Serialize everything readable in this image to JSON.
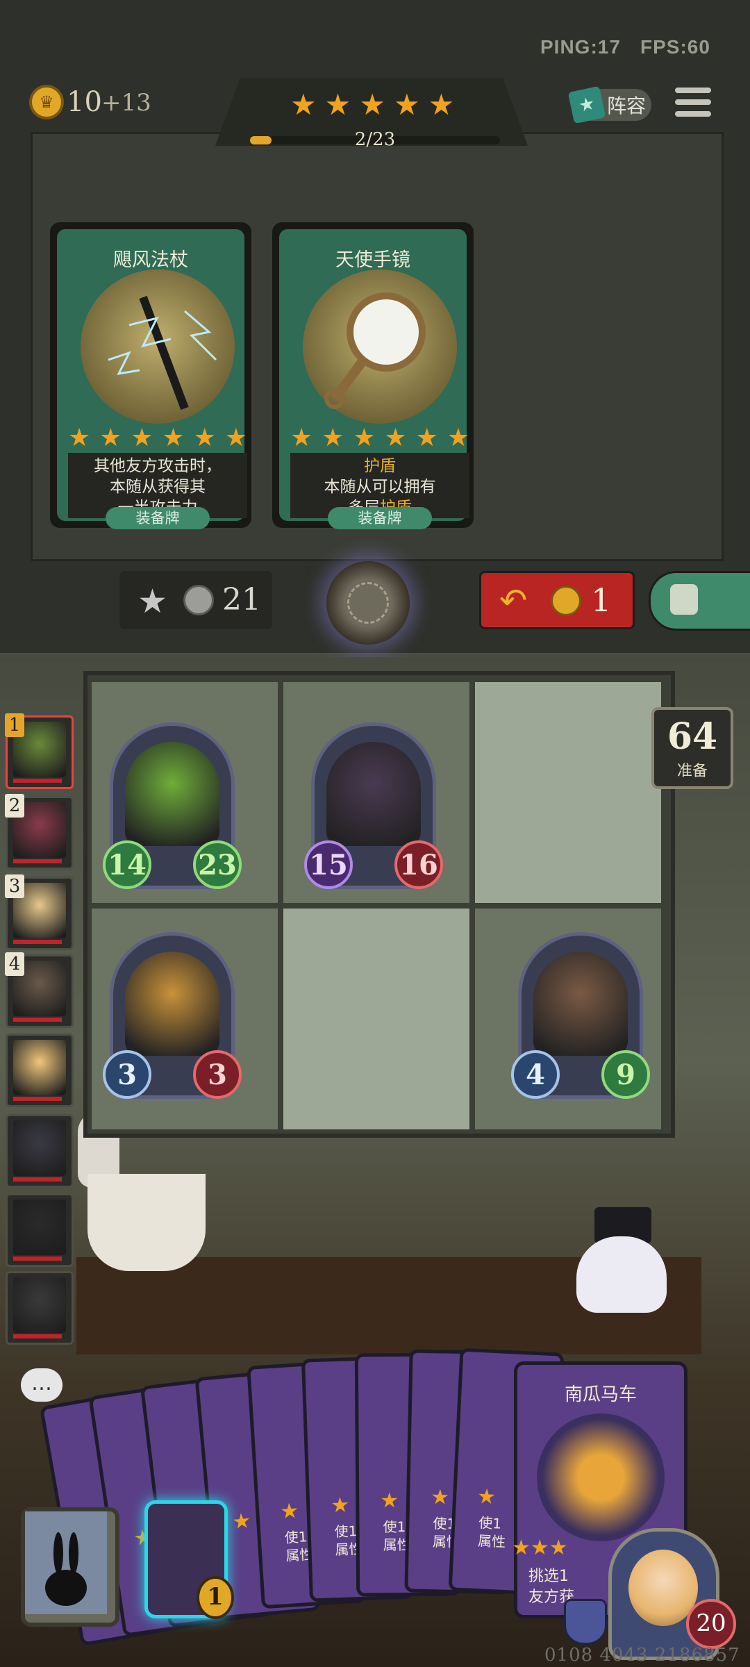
{
  "hud": {
    "ping_label": "PING:17",
    "fps_label": "FPS:60",
    "gold": "10",
    "gold_income": "+13",
    "tier_stars": [
      "★",
      "★",
      "★",
      "★",
      "★"
    ],
    "tier_progress_text": "2/23",
    "tier_progress_fraction": 0.087,
    "lineup_label": "阵容",
    "lineup_icon": "lineup-card-icon",
    "menu_icon": "hamburger-icon"
  },
  "shop": {
    "cards": [
      {
        "title": "飓风法杖",
        "stars": [
          "★",
          "★",
          "★",
          "★",
          "★",
          "★"
        ],
        "desc_lines": [
          "其他友方攻击时，",
          "本随从获得其",
          "一半攻击力"
        ],
        "tag": "装备牌",
        "art_icon": "lightning-staff-icon"
      },
      {
        "title": "天使手镜",
        "stars": [
          "★",
          "★",
          "★",
          "★",
          "★",
          "★"
        ],
        "keyword": "护盾",
        "desc_lines": [
          "本随从可以拥有",
          "多层"
        ],
        "desc_keyword_inline": "护盾",
        "tag": "装备牌",
        "art_icon": "hand-mirror-icon"
      }
    ],
    "upgrade_cost": "21",
    "upgrade_icon": "star-up-icon",
    "refresh_cost": "1",
    "refresh_icon": "refresh-arrow-icon",
    "lock_icon": "unlock-icon",
    "watch_icon": "pocket-watch-icon",
    "colors": {
      "refresh_bg": "#b82523",
      "lock_bg": "#3f8a6a",
      "gold": "#e0a826"
    }
  },
  "board": {
    "minions": [
      {
        "name": "leaf-girl",
        "attack": "14",
        "health": "23",
        "atk_style": "g",
        "hp_style": "g",
        "face": "#6fae3a"
      },
      {
        "name": "demon-skull",
        "attack": "15",
        "health": "16",
        "atk_style": "p",
        "hp_style": "r",
        "face": "#4a3a52"
      },
      {
        "name": "golden-paladin",
        "attack": "3",
        "health": "3",
        "atk_style": "b",
        "hp_style": "r",
        "face": "#c9923a"
      },
      {
        "name": "mohawk-warrior",
        "attack": "4",
        "health": "9",
        "atk_style": "b",
        "hp_style": "g",
        "face": "#7a5a44"
      }
    ],
    "ready_count": "64",
    "ready_label": "准备"
  },
  "lineup": {
    "slots": [
      {
        "num": "1",
        "face": "#6a8a3a"
      },
      {
        "num": "2",
        "face": "#8a3a4a"
      },
      {
        "num": "3",
        "face": "#e6c88a"
      },
      {
        "num": "4",
        "face": "#6a5a4a"
      },
      {
        "num": "",
        "face": "#f0c67a"
      },
      {
        "num": "",
        "face": "#3a3a44"
      },
      {
        "num": "",
        "face": "#2a2a2a"
      },
      {
        "num": "",
        "face": "#3a3a3a"
      }
    ]
  },
  "hand": {
    "cards": [
      {
        "text": ""
      },
      {
        "text": ""
      },
      {
        "text": ""
      },
      {
        "text": ""
      },
      {
        "text": "使1\n属性"
      },
      {
        "text": "使1\n属性"
      },
      {
        "text": "使1\n属性"
      },
      {
        "text": "使1\n属性"
      },
      {
        "text": "使1\n属性"
      }
    ],
    "featured_title": "南瓜马车",
    "featured_stars": "★★★",
    "featured_desc": "挑选1\n友方获",
    "selected_cost": "1",
    "emote_icon": "chat-bubble-icon",
    "deck_icon": "rabbit-silhouette-icon"
  },
  "hero": {
    "health": "20",
    "armor_icon": "shield-icon"
  },
  "footer": {
    "build_id": "0108 4043 2186857"
  }
}
